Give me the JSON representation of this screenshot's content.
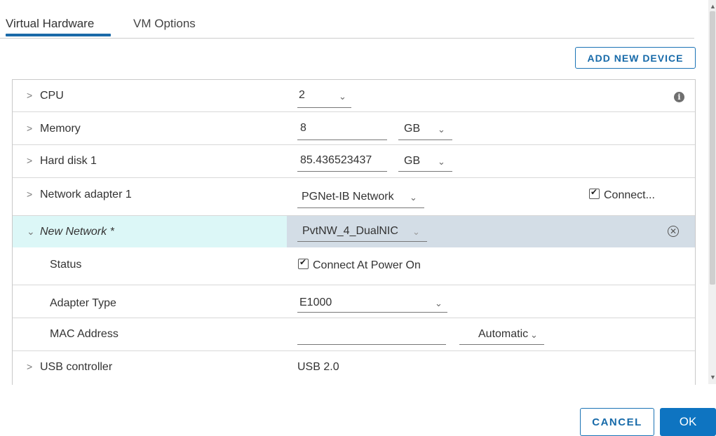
{
  "tabs": [
    {
      "label": "Virtual Hardware",
      "active": true
    },
    {
      "label": "VM Options",
      "active": false
    }
  ],
  "add_device_label": "ADD NEW DEVICE",
  "rows": {
    "cpu": {
      "label": "CPU",
      "value": "2"
    },
    "memory": {
      "label": "Memory",
      "value": "8",
      "unit": "GB"
    },
    "hard_disk": {
      "label": "Hard disk 1",
      "value": "85.436523437",
      "unit": "GB"
    },
    "network_adapter": {
      "label": "Network adapter 1",
      "value": "PGNet-IB Network",
      "connect_label": "Connect...",
      "connected": true
    },
    "new_network": {
      "label": "New Network *",
      "value": "PvtNW_4_DualNIC"
    },
    "status": {
      "label": "Status",
      "value": "Connect At Power On",
      "checked": true
    },
    "adapter_type": {
      "label": "Adapter Type",
      "value": "E1000"
    },
    "mac_address": {
      "label": "MAC Address",
      "value": "",
      "mode": "Automatic"
    },
    "usb_controller": {
      "label": "USB controller",
      "value": "USB 2.0"
    }
  },
  "icons": {
    "info": "info-icon",
    "remove": "remove-icon"
  },
  "colors": {
    "accent": "#1b6aa8",
    "selected_row_label_bg": "#dcf7f7",
    "selected_row_value_bg": "#d3dde6",
    "ok_bg": "#0e74c1"
  },
  "footer": {
    "cancel_label": "CANCEL",
    "ok_label": "OK"
  }
}
